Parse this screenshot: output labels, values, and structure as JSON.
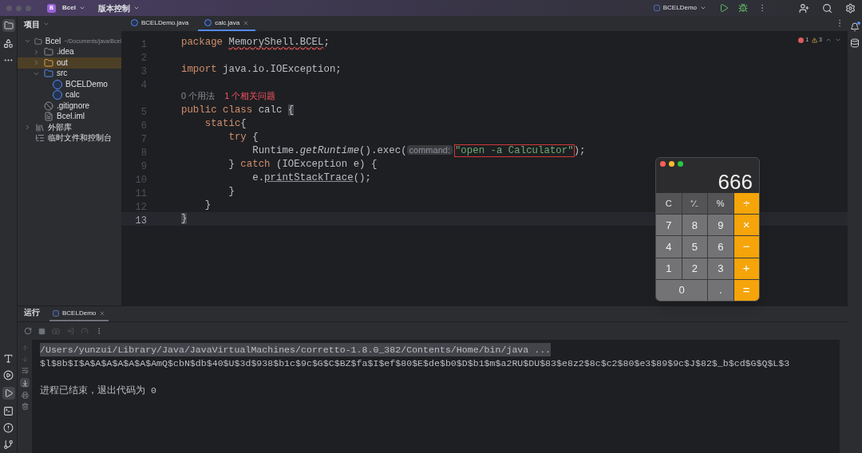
{
  "titlebar": {
    "project_badge": "B",
    "project": "Bcel",
    "vcs": "版本控制",
    "run_config": "BCELDemo"
  },
  "project_panel": {
    "title": "项目",
    "tree": [
      {
        "label": "Bcel",
        "hint": "~/Documents/java/Bcel",
        "kind": "module",
        "expanded": true,
        "selected": false,
        "children": [
          {
            "label": ".idea",
            "kind": "folder",
            "expanded": false,
            "selected": false
          },
          {
            "label": "out",
            "kind": "excluded",
            "expanded": false,
            "selected": true
          },
          {
            "label": "src",
            "kind": "source",
            "expanded": true,
            "selected": false,
            "children": [
              {
                "label": "BCELDemo",
                "kind": "class",
                "selected": false
              },
              {
                "label": "calc",
                "kind": "class",
                "selected": false
              }
            ]
          },
          {
            "label": ".gitignore",
            "kind": "ignore",
            "selected": false
          },
          {
            "label": "Bcel.iml",
            "kind": "file",
            "selected": false
          }
        ]
      },
      {
        "label": "外部库",
        "kind": "library",
        "expanded": false,
        "selected": false
      },
      {
        "label": "临时文件和控制台",
        "kind": "scratch",
        "selected": false
      }
    ]
  },
  "editor_tabs": [
    {
      "label": "BCELDemo.java",
      "selected": false
    },
    {
      "label": "calc.java",
      "selected": true
    }
  ],
  "inspections": {
    "errors": "1",
    "warnings": "3"
  },
  "code_lines": [
    {
      "number": "1",
      "current": false,
      "tokens": [
        {
          "text": "package ",
          "kind": "keyword"
        },
        {
          "text": "MemoryShell.BCEL",
          "kind": "warn"
        },
        {
          "text": ";",
          "kind": "plain"
        }
      ]
    },
    {
      "number": "2",
      "current": false
    },
    {
      "number": "3",
      "current": false,
      "tokens": [
        {
          "text": "import ",
          "kind": "keyword"
        },
        {
          "text": "java.io.IOException;",
          "kind": "plain"
        }
      ]
    },
    {
      "number": "4",
      "current": false
    },
    {
      "current": false,
      "tokens": [
        {
          "text": "0 个用法",
          "kind": "usage"
        },
        {
          "text": "1 个相关问题",
          "kind": "problem"
        }
      ]
    },
    {
      "number": "5",
      "current": false,
      "tokens": [
        {
          "text": "public class ",
          "kind": "keyword"
        },
        {
          "text": "calc ",
          "kind": "plain"
        },
        {
          "text": "{",
          "kind": "brace"
        }
      ]
    },
    {
      "number": "6",
      "current": false,
      "tokens": [
        {
          "text": "    static",
          "kind": "keyword"
        },
        {
          "text": "{",
          "kind": "plain"
        }
      ]
    },
    {
      "number": "7",
      "current": false,
      "tokens": [
        {
          "text": "        try ",
          "kind": "keyword"
        },
        {
          "text": "{",
          "kind": "plain"
        }
      ]
    },
    {
      "number": "8",
      "current": false,
      "tokens": [
        {
          "text": "            Runtime.",
          "kind": "plain"
        },
        {
          "text": "getRuntime",
          "kind": "static"
        },
        {
          "text": "().exec(",
          "kind": "plain"
        },
        {
          "text": "command:",
          "kind": "param"
        },
        {
          "text": "\"open -a Calculator\"",
          "kind": "string"
        },
        {
          "text": ");",
          "kind": "plain"
        }
      ]
    },
    {
      "number": "9",
      "current": false,
      "tokens": [
        {
          "text": "        } ",
          "kind": "plain"
        },
        {
          "text": "catch ",
          "kind": "keyword"
        },
        {
          "text": "(IOException e) {",
          "kind": "plain"
        }
      ]
    },
    {
      "number": "10",
      "current": false,
      "tokens": [
        {
          "text": "            e.",
          "kind": "plain"
        },
        {
          "text": "printStackTrace",
          "kind": "underlined"
        },
        {
          "text": "();",
          "kind": "plain"
        }
      ]
    },
    {
      "number": "11",
      "current": false,
      "tokens": [
        {
          "text": "        }",
          "kind": "plain"
        }
      ]
    },
    {
      "number": "12",
      "current": false,
      "tokens": [
        {
          "text": "    }",
          "kind": "plain"
        }
      ]
    },
    {
      "number": "13",
      "current": true,
      "tokens": [
        {
          "text": "}",
          "kind": "brace"
        }
      ]
    }
  ],
  "calculator": {
    "display": "666",
    "keys": [
      {
        "label": "C",
        "kind": "function"
      },
      {
        "label": "⁺∕₋",
        "kind": "function"
      },
      {
        "label": "%",
        "kind": "function"
      },
      {
        "label": "÷",
        "kind": "operator"
      },
      {
        "label": "7",
        "kind": "digit"
      },
      {
        "label": "8",
        "kind": "digit"
      },
      {
        "label": "9",
        "kind": "digit"
      },
      {
        "label": "×",
        "kind": "operator"
      },
      {
        "label": "4",
        "kind": "digit"
      },
      {
        "label": "5",
        "kind": "digit"
      },
      {
        "label": "6",
        "kind": "digit"
      },
      {
        "label": "−",
        "kind": "operator"
      },
      {
        "label": "1",
        "kind": "digit"
      },
      {
        "label": "2",
        "kind": "digit"
      },
      {
        "label": "3",
        "kind": "digit"
      },
      {
        "label": "+",
        "kind": "operator"
      },
      {
        "label": "0",
        "kind": "wide"
      },
      {
        "label": ".",
        "kind": "digit"
      },
      {
        "label": "=",
        "kind": "operator"
      }
    ]
  },
  "run_panel": {
    "title": "运行",
    "tabs": [
      {
        "label": "BCELDemo",
        "selected": true
      }
    ],
    "console": [
      {
        "text": "/Users/yunzui/Library/Java/JavaVirtualMachines/corretto-1.8.0_382/Contents/Home/bin/java ...",
        "kind": "command"
      },
      {
        "text": "$l$8b$I$A$A$A$A$A$A$AmQ$cbN$db$40$U$3d$938$b1c$9c$G$C$BZ$fa$I$ef$80$E$de$b0$D$b1$m$a2RU$DU$83$e8z2$8c$c2$80$e3$89$9c$J$82$_b$cd$G$Q$L$3",
        "kind": "output"
      },
      {
        "kind": "blank"
      },
      {
        "text": "进程已结束，退出代码为 0",
        "kind": "output"
      }
    ]
  }
}
